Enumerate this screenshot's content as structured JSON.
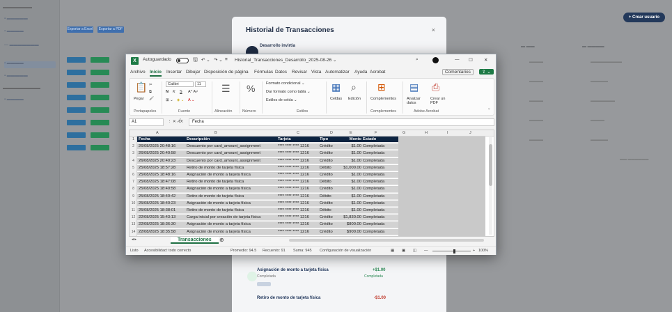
{
  "background_app": {
    "title": "Historial de Transacciones",
    "close_label": "×",
    "subtitle": "Desarrollo invirtia",
    "new_button": "+ Crear usuario",
    "export_buttons": [
      "Exportar a Excel",
      "Exportar a PDF"
    ],
    "item1_title": "Asignación de monto a tarjeta física",
    "item1_sub": "Completada",
    "item1_amount": "+$1.00",
    "item1_amount_sub": "Completada",
    "item2_title": "Retiro de monto de tarjeta física",
    "item2_amount": "-$1.00"
  },
  "excel": {
    "autosave_label": "Autoguardado",
    "filename": "Historial_Transacciones_Desarrollo_2025-08-26 ⌄",
    "tabs": [
      "Archivo",
      "Inicio",
      "Insertar",
      "Dibujar",
      "Disposición de página",
      "Fórmulas",
      "Datos",
      "Revisar",
      "Vista",
      "Automatizar",
      "Ayuda",
      "Acrobat"
    ],
    "active_tab": "Inicio",
    "comments_label": "Comentarios",
    "ribbon_groups": [
      "Portapapeles",
      "Fuente",
      "Alineación",
      "Número",
      "Estilos",
      "Celdas",
      "Edición",
      "Complementos",
      "Adobe Acrobat"
    ],
    "ribbon_items": {
      "paste": "Pegar",
      "font_name": "Calibri",
      "font_size": "11",
      "conditional_format": "Formato condicional ⌄",
      "table_format": "Dar formato como tabla ⌄",
      "cell_styles": "Estilos de celda ⌄",
      "cells": "Celdas",
      "edit": "Edición",
      "addins": "Complementos",
      "analyze": "Analizar datos",
      "create_pdf": "Crear un PDF"
    },
    "namebox": "A1",
    "fx": "fx",
    "formula": "Fecha",
    "columns": [
      "A",
      "B",
      "C",
      "D",
      "E",
      "F",
      "G",
      "H",
      "I",
      "J"
    ],
    "table_header": [
      "Fecha",
      "Descripción",
      "Tarjeta",
      "Tipo",
      "Monto",
      "Estado"
    ],
    "rows": [
      [
        "26/08/2025 20:48:16",
        "Descuento por card_amount_assignment",
        "**** **** **** 1216",
        "Crédito",
        "$1.00",
        "Completada"
      ],
      [
        "26/08/2025 20:40:58",
        "Descuento por card_amount_assignment",
        "**** **** **** 1216",
        "Crédito",
        "$1.00",
        "Completada"
      ],
      [
        "26/08/2025 20:40:23",
        "Descuento por card_amount_assignment",
        "**** **** **** 1216",
        "Crédito",
        "$1.00",
        "Completada"
      ],
      [
        "25/08/2025 18:57:28",
        "Retiro de monto de tarjeta física",
        "**** **** **** 1216",
        "Débito",
        "$1,000.00",
        "Completada"
      ],
      [
        "25/08/2025 18:48:16",
        "Asignación de monto a tarjeta física",
        "**** **** **** 1216",
        "Crédito",
        "$1.00",
        "Completada"
      ],
      [
        "25/08/2025 18:47:08",
        "Retiro de monto de tarjeta física",
        "**** **** **** 1216",
        "Débito",
        "$1.00",
        "Completada"
      ],
      [
        "25/08/2025 18:40:58",
        "Asignación de monto a tarjeta física",
        "**** **** **** 1216",
        "Crédito",
        "$1.00",
        "Completada"
      ],
      [
        "25/08/2025 18:40:42",
        "Retiro de monto de tarjeta física",
        "**** **** **** 1216",
        "Débito",
        "$1.00",
        "Completada"
      ],
      [
        "25/08/2025 18:40:23",
        "Asignación de monto a tarjeta física",
        "**** **** **** 1216",
        "Crédito",
        "$1.00",
        "Completada"
      ],
      [
        "25/08/2025 18:38:01",
        "Retiro de monto de tarjeta física",
        "**** **** **** 1216",
        "Débito",
        "$1.00",
        "Completada"
      ],
      [
        "22/08/2025 15:43:13",
        "Carga inicial por creación de tarjeta física",
        "**** **** **** 1216",
        "Crédito",
        "$1,830.00",
        "Completada"
      ],
      [
        "22/08/2025 18:36:30",
        "Asignación de monto a tarjeta física",
        "**** **** **** 1216",
        "Crédito",
        "$800.00",
        "Completada"
      ],
      [
        "22/08/2025 18:35:58",
        "Asignación de monto a tarjeta física",
        "**** **** **** 1216",
        "Crédito",
        "$900.00",
        "Completada"
      ]
    ],
    "row_numbers": [
      "1",
      "2",
      "3",
      "4",
      "5",
      "6",
      "7",
      "8",
      "9",
      "10",
      "11",
      "12",
      "13",
      "14"
    ],
    "sheet_tab": "Transacciones",
    "status": {
      "ready": "Listo",
      "accessibility": "Accesibilidad: todo correcto",
      "average": "Promedio: 94.5",
      "count": "Recuento: 91",
      "sum": "Suma: 945",
      "display_settings": "Configuración de visualización",
      "zoom": "100%"
    }
  },
  "colors": {
    "excel_green": "#1d6f42",
    "header_navy": "#0c2340",
    "selection_gray": "#d2d2d2"
  }
}
